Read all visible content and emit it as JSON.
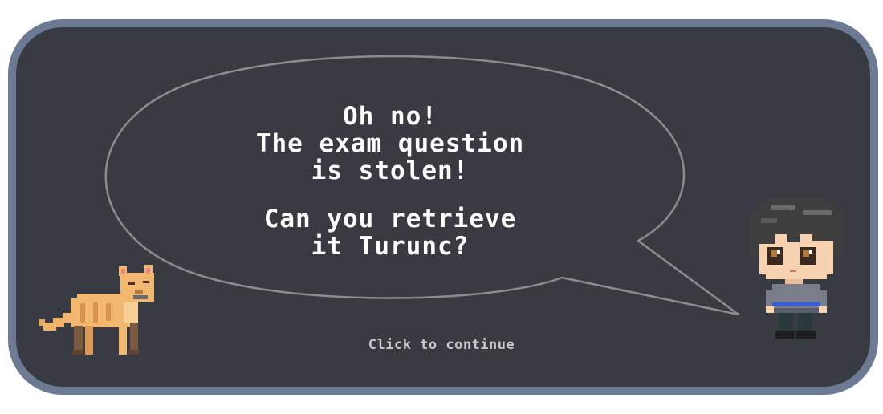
{
  "dialog": {
    "lines_top": [
      "Oh no!",
      "The exam question",
      "is stolen!"
    ],
    "lines_bottom": [
      "Can you retrieve",
      "it Turunc?"
    ],
    "continue_label": "Click to continue"
  },
  "colors": {
    "background": "#ffffff",
    "panel_fill": "#383b41",
    "panel_border": "#6c7a94",
    "bubble_outline": "#8d8d8d",
    "text": "#ffffff",
    "hint_text": "#c9c9c9"
  },
  "icons": {
    "cat": "pixel-cat-icon",
    "speaker": "pixel-boy-character-icon"
  }
}
